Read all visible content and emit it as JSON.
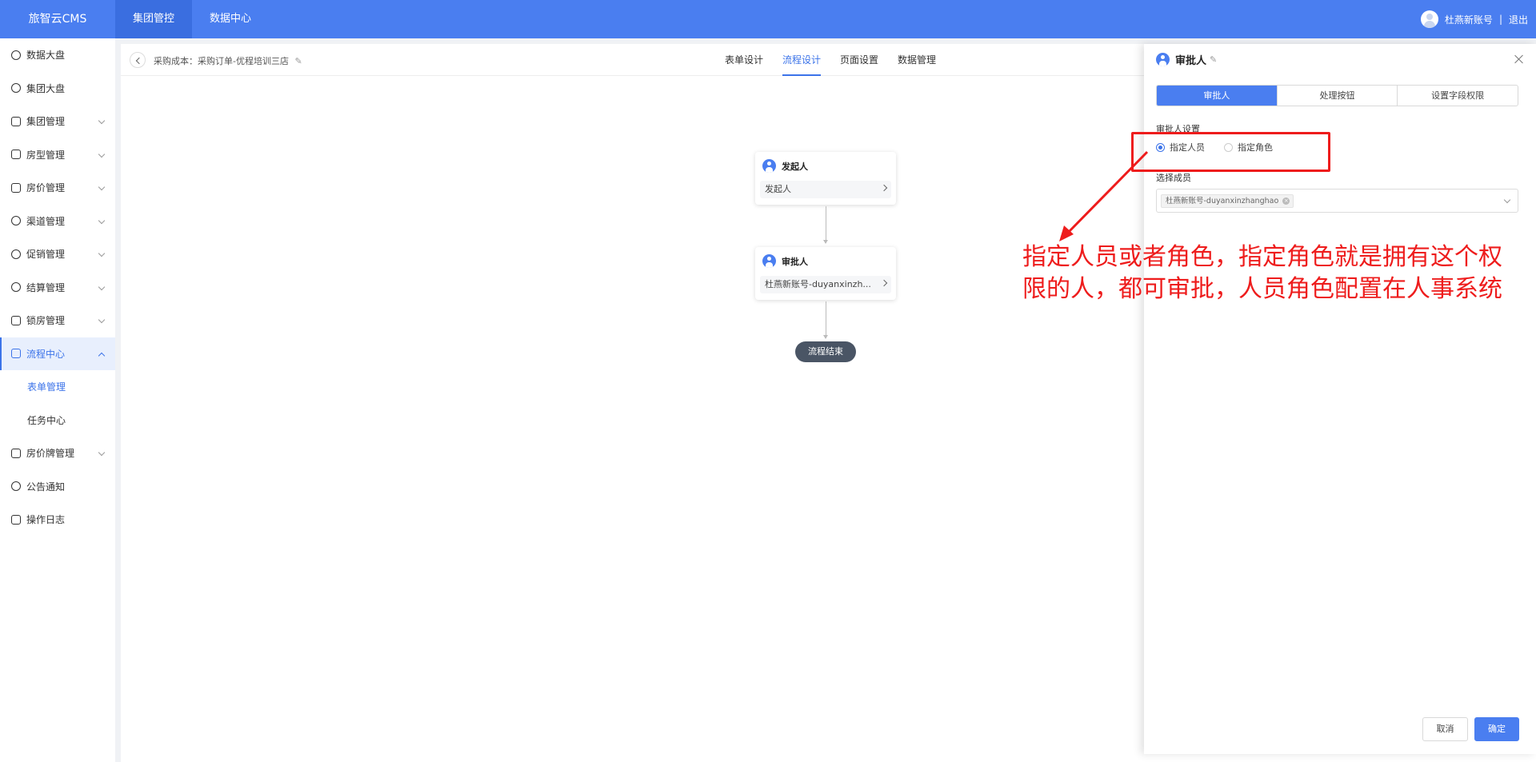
{
  "topbar": {
    "brand": "旅智云CMS",
    "nav": [
      "集团管控",
      "数据中心"
    ],
    "user_name": "杜燕新账号",
    "separator": "|",
    "logout": "退出"
  },
  "sidebar": {
    "items": [
      {
        "label": "数据大盘"
      },
      {
        "label": "集团大盘"
      },
      {
        "label": "集团管理"
      },
      {
        "label": "房型管理"
      },
      {
        "label": "房价管理"
      },
      {
        "label": "渠道管理"
      },
      {
        "label": "促销管理"
      },
      {
        "label": "结算管理"
      },
      {
        "label": "锁房管理"
      },
      {
        "label": "流程中心"
      },
      {
        "label": "表单管理"
      },
      {
        "label": "任务中心"
      },
      {
        "label": "房价牌管理"
      },
      {
        "label": "公告通知"
      },
      {
        "label": "操作日志"
      }
    ]
  },
  "main": {
    "breadcrumb": "采购成本：采购订单-优程培训三店",
    "tabs": [
      "表单设计",
      "流程设计",
      "页面设置",
      "数据管理"
    ],
    "active_tab": "流程设计"
  },
  "flow": {
    "start": {
      "title": "发起人",
      "body": "发起人"
    },
    "approver": {
      "title": "审批人",
      "body": "杜燕新账号-duyanxinzh..."
    },
    "end": "流程结束"
  },
  "drawer": {
    "title": "审批人",
    "tabs": [
      "审批人",
      "处理按钮",
      "设置字段权限"
    ],
    "settings_label": "审批人设置",
    "radio_options": [
      "指定人员",
      "指定角色"
    ],
    "selected_radio": "指定人员",
    "members_label": "选择成员",
    "member_tag": "杜燕新账号-duyanxinzhanghao",
    "cancel": "取消",
    "confirm": "确定"
  },
  "annotation": {
    "text": "指定人员或者角色，指定角色就是拥有这个权限的人，都可审批，人员角色配置在人事系统",
    "color": "#ee1c1c"
  },
  "colors": {
    "primary": "#4a7ef0",
    "accent_text": "#3b73e9",
    "end_node": "#4a5565"
  },
  "icons": {
    "sidebar": [
      "clock-icon",
      "clock-icon",
      "monitor-icon",
      "home-icon",
      "card-icon",
      "share-icon",
      "tag-icon",
      "yen-icon",
      "lock-doc-icon",
      "clipboard-icon",
      "none",
      "none",
      "board-icon",
      "bell-icon",
      "doc-icon"
    ]
  }
}
